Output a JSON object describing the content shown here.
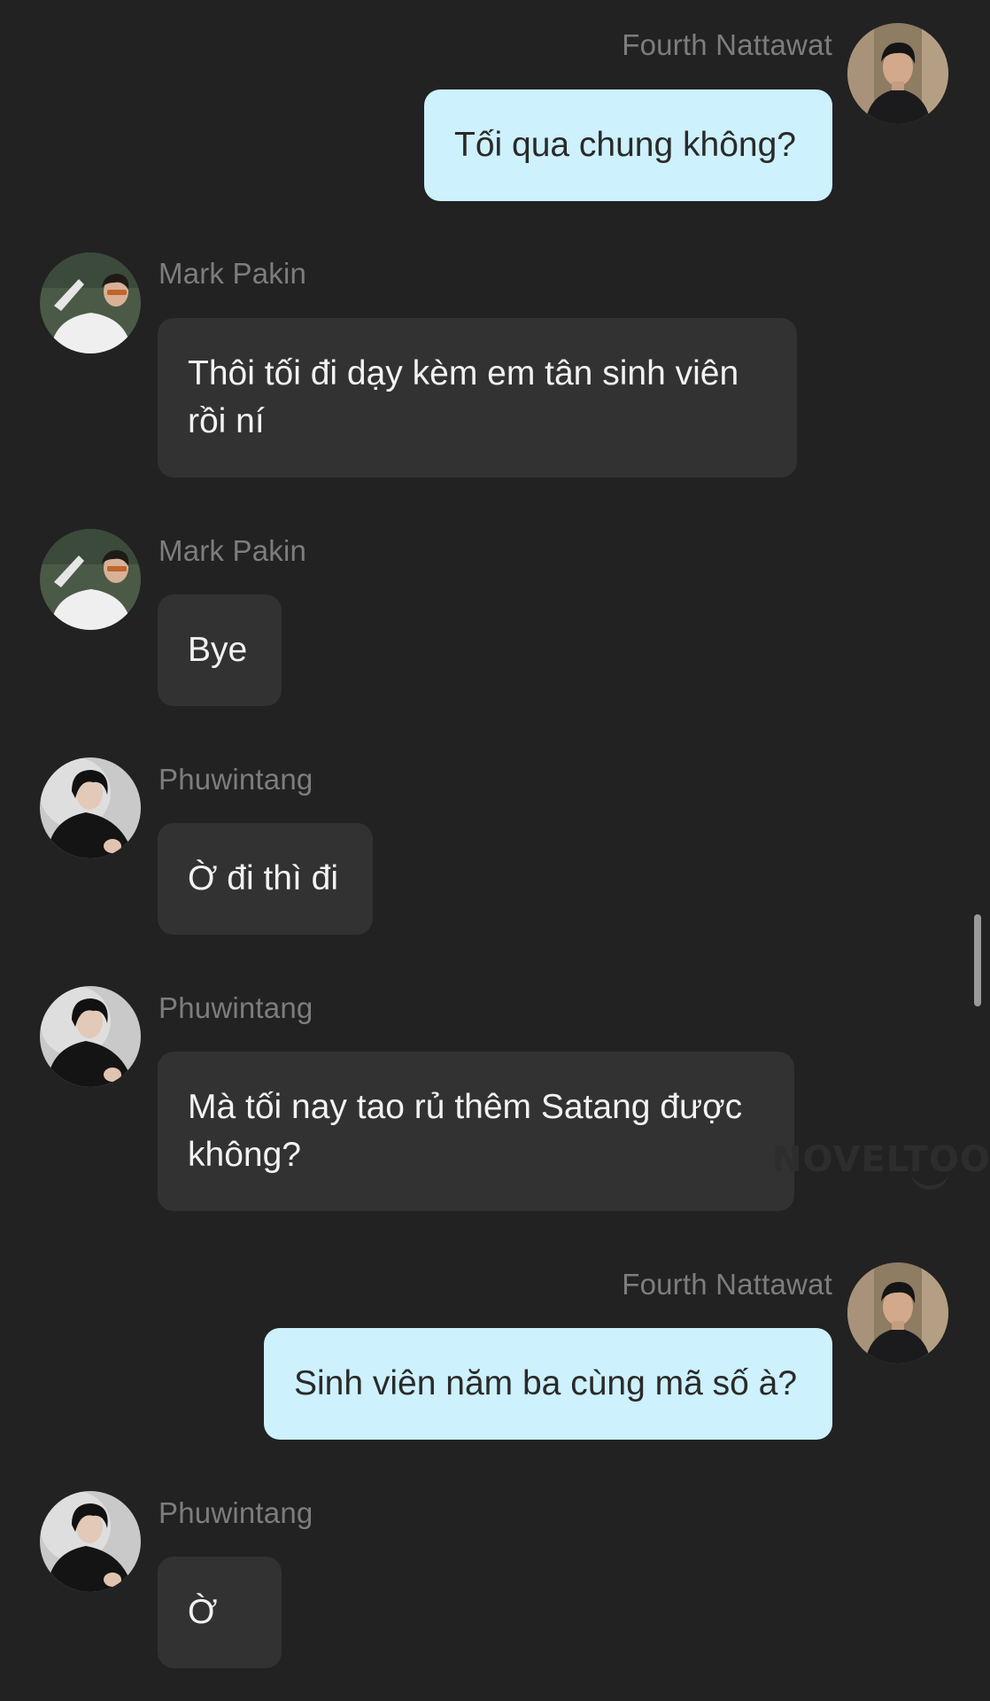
{
  "messages": [
    {
      "sender": "Fourth Nattawat",
      "text": "Tối qua chung không?",
      "side": "right"
    },
    {
      "sender": "Mark Pakin",
      "text": "Thôi tối đi dạy kèm em tân sinh viên rồi ní",
      "side": "left"
    },
    {
      "sender": "Mark Pakin",
      "text": "Bye",
      "side": "left"
    },
    {
      "sender": "Phuwintang",
      "text": "Ờ đi thì đi",
      "side": "left"
    },
    {
      "sender": "Phuwintang",
      "text": "Mà tối nay tao rủ thêm Satang được không?",
      "side": "left"
    },
    {
      "sender": "Fourth Nattawat",
      "text": "Sinh viên năm ba cùng mã số à?",
      "side": "right"
    },
    {
      "sender": "Phuwintang",
      "text": "Ờ",
      "side": "left"
    }
  ],
  "watermark": "NOVELTOON",
  "colors": {
    "background": "#222222",
    "my_bubble": "#cdf1fd",
    "their_bubble": "#323232",
    "sender_name": "#7d7d7d"
  }
}
